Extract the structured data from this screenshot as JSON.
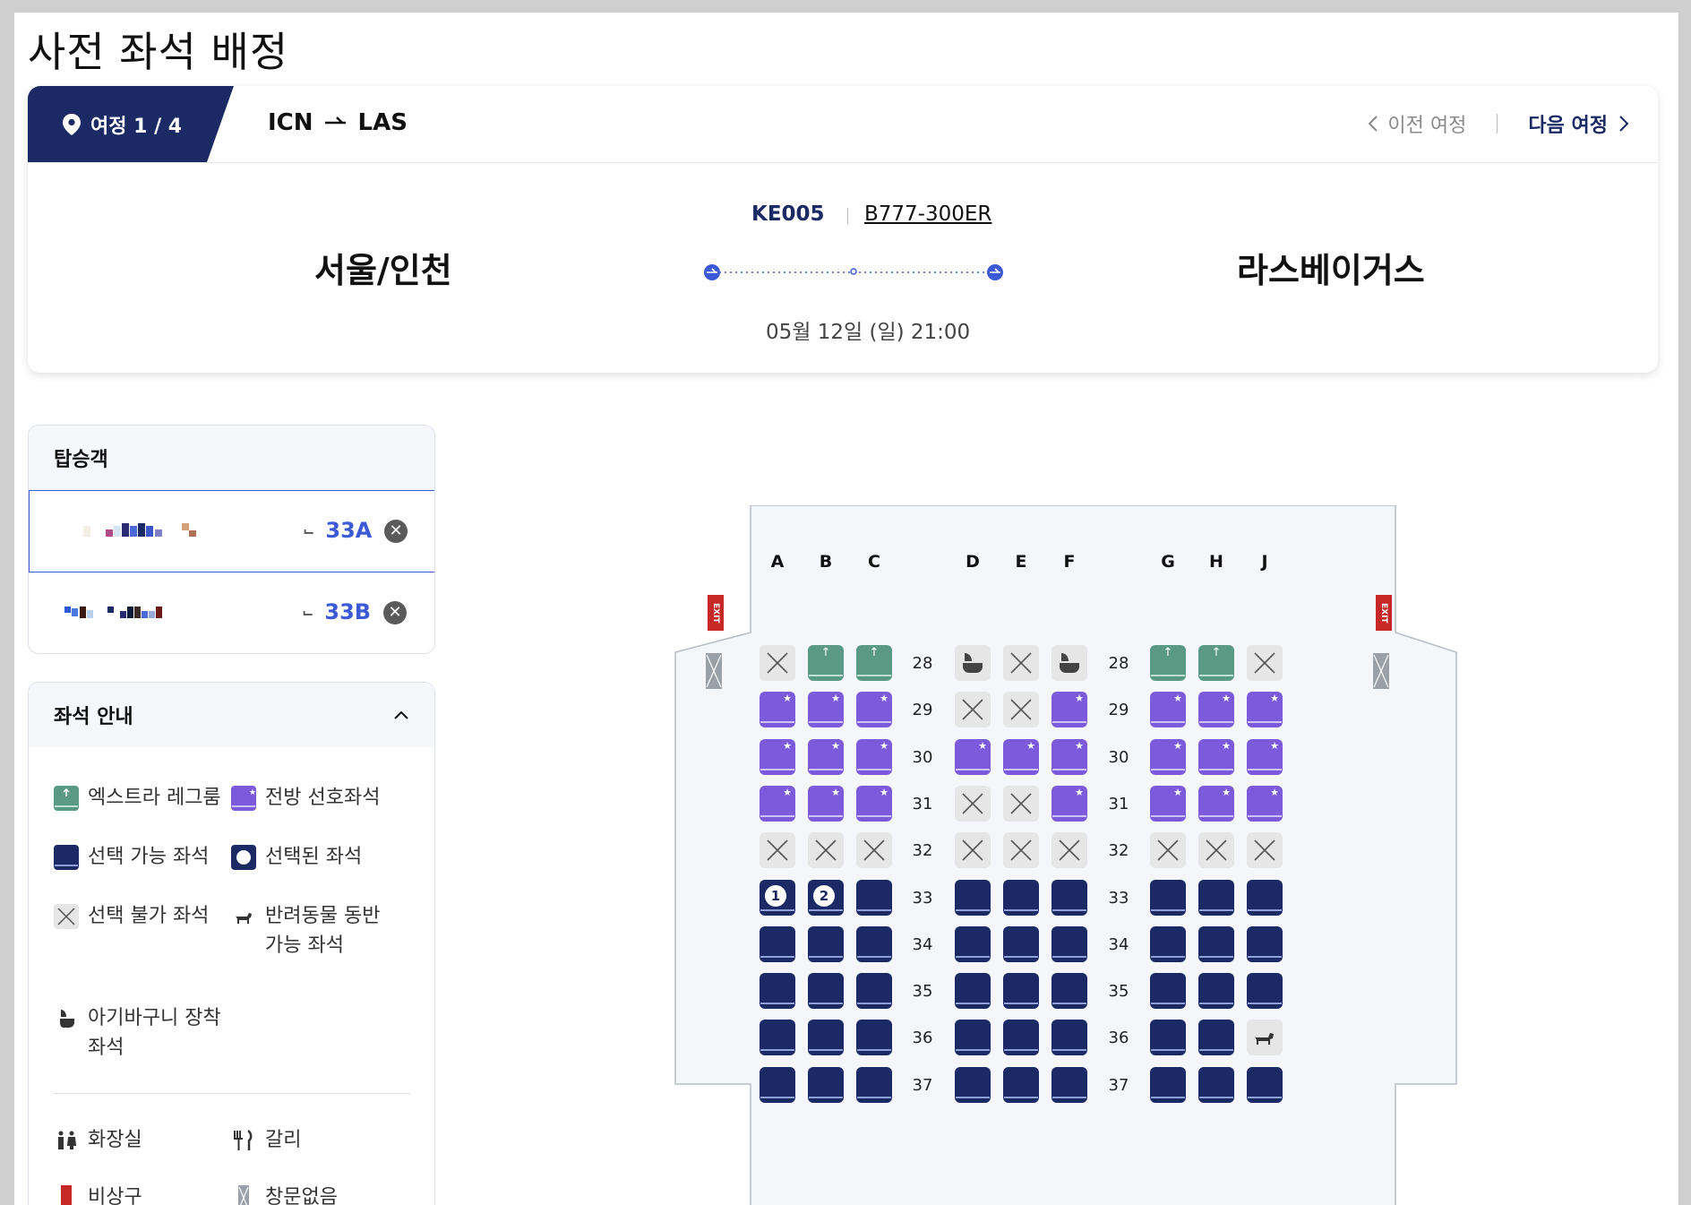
{
  "page": {
    "title": "사전 좌석 배정"
  },
  "journey": {
    "label": "여정 1 / 4",
    "origin_code": "ICN",
    "dest_code": "LAS",
    "prev_label": "이전 여정",
    "next_label": "다음 여정"
  },
  "flight": {
    "number": "KE005",
    "aircraft": "B777-300ER",
    "origin": "서울/인천",
    "destination": "라스베이거스",
    "date": "05월 12일 (일) 21:00"
  },
  "passengers": {
    "title": "탑승객",
    "items": [
      {
        "seat": "33A",
        "selected": true
      },
      {
        "seat": "33B",
        "selected": false
      }
    ]
  },
  "legend": {
    "title": "좌석 안내",
    "items": [
      {
        "label": "엑스트라 레그룸",
        "icon": "extra-legroom-seat-icon"
      },
      {
        "label": "전방 선호좌석",
        "icon": "front-preferred-seat-icon"
      },
      {
        "label": "선택 가능 좌석",
        "icon": "available-seat-icon"
      },
      {
        "label": "선택된 좌석",
        "icon": "selected-seat-icon"
      },
      {
        "label": "선택 불가 좌석",
        "icon": "unavailable-seat-icon"
      },
      {
        "label": "반려동물 동반",
        "label2": "가능 좌석",
        "icon": "pet-seat-icon"
      },
      {
        "label": "아기바구니 장착",
        "label2": "좌석",
        "icon": "bassinet-seat-icon"
      },
      {
        "label": "화장실",
        "icon": "lavatory-icon"
      },
      {
        "label": "갈리",
        "icon": "galley-icon"
      },
      {
        "label": "비상구",
        "icon": "exit-icon"
      },
      {
        "label": "창문없음",
        "icon": "no-window-icon"
      }
    ]
  },
  "seatmap": {
    "columns_left": [
      "A",
      "B",
      "C"
    ],
    "columns_mid": [
      "D",
      "E",
      "F"
    ],
    "columns_right": [
      "G",
      "H",
      "J"
    ],
    "exit_label": "EXIT",
    "rows": [
      {
        "row": "28",
        "seats": [
          "blocked",
          "extra",
          "extra",
          "bassinet",
          "blocked",
          "bassinet",
          "extra",
          "extra",
          "blocked"
        ]
      },
      {
        "row": "29",
        "seats": [
          "front",
          "front",
          "front",
          "blocked",
          "blocked",
          "front",
          "front",
          "front",
          "front"
        ]
      },
      {
        "row": "30",
        "seats": [
          "front",
          "front",
          "front",
          "front",
          "front",
          "front",
          "front",
          "front",
          "front"
        ]
      },
      {
        "row": "31",
        "seats": [
          "front",
          "front",
          "front",
          "blocked",
          "blocked",
          "front",
          "front",
          "front",
          "front"
        ]
      },
      {
        "row": "32",
        "seats": [
          "blocked",
          "blocked",
          "blocked",
          "blocked",
          "blocked",
          "blocked",
          "blocked",
          "blocked",
          "blocked"
        ]
      },
      {
        "row": "33",
        "seats": [
          "sel1",
          "sel2",
          "avail",
          "avail",
          "avail",
          "avail",
          "avail",
          "avail",
          "avail"
        ]
      },
      {
        "row": "34",
        "seats": [
          "avail",
          "avail",
          "avail",
          "avail",
          "avail",
          "avail",
          "avail",
          "avail",
          "avail"
        ]
      },
      {
        "row": "35",
        "seats": [
          "avail",
          "avail",
          "avail",
          "avail",
          "avail",
          "avail",
          "avail",
          "avail",
          "avail"
        ]
      },
      {
        "row": "36",
        "seats": [
          "avail",
          "avail",
          "avail",
          "avail",
          "avail",
          "avail",
          "avail",
          "avail",
          "pet"
        ]
      },
      {
        "row": "37",
        "seats": [
          "avail",
          "avail",
          "avail",
          "avail",
          "avail",
          "avail",
          "avail",
          "avail",
          "avail"
        ]
      }
    ]
  }
}
